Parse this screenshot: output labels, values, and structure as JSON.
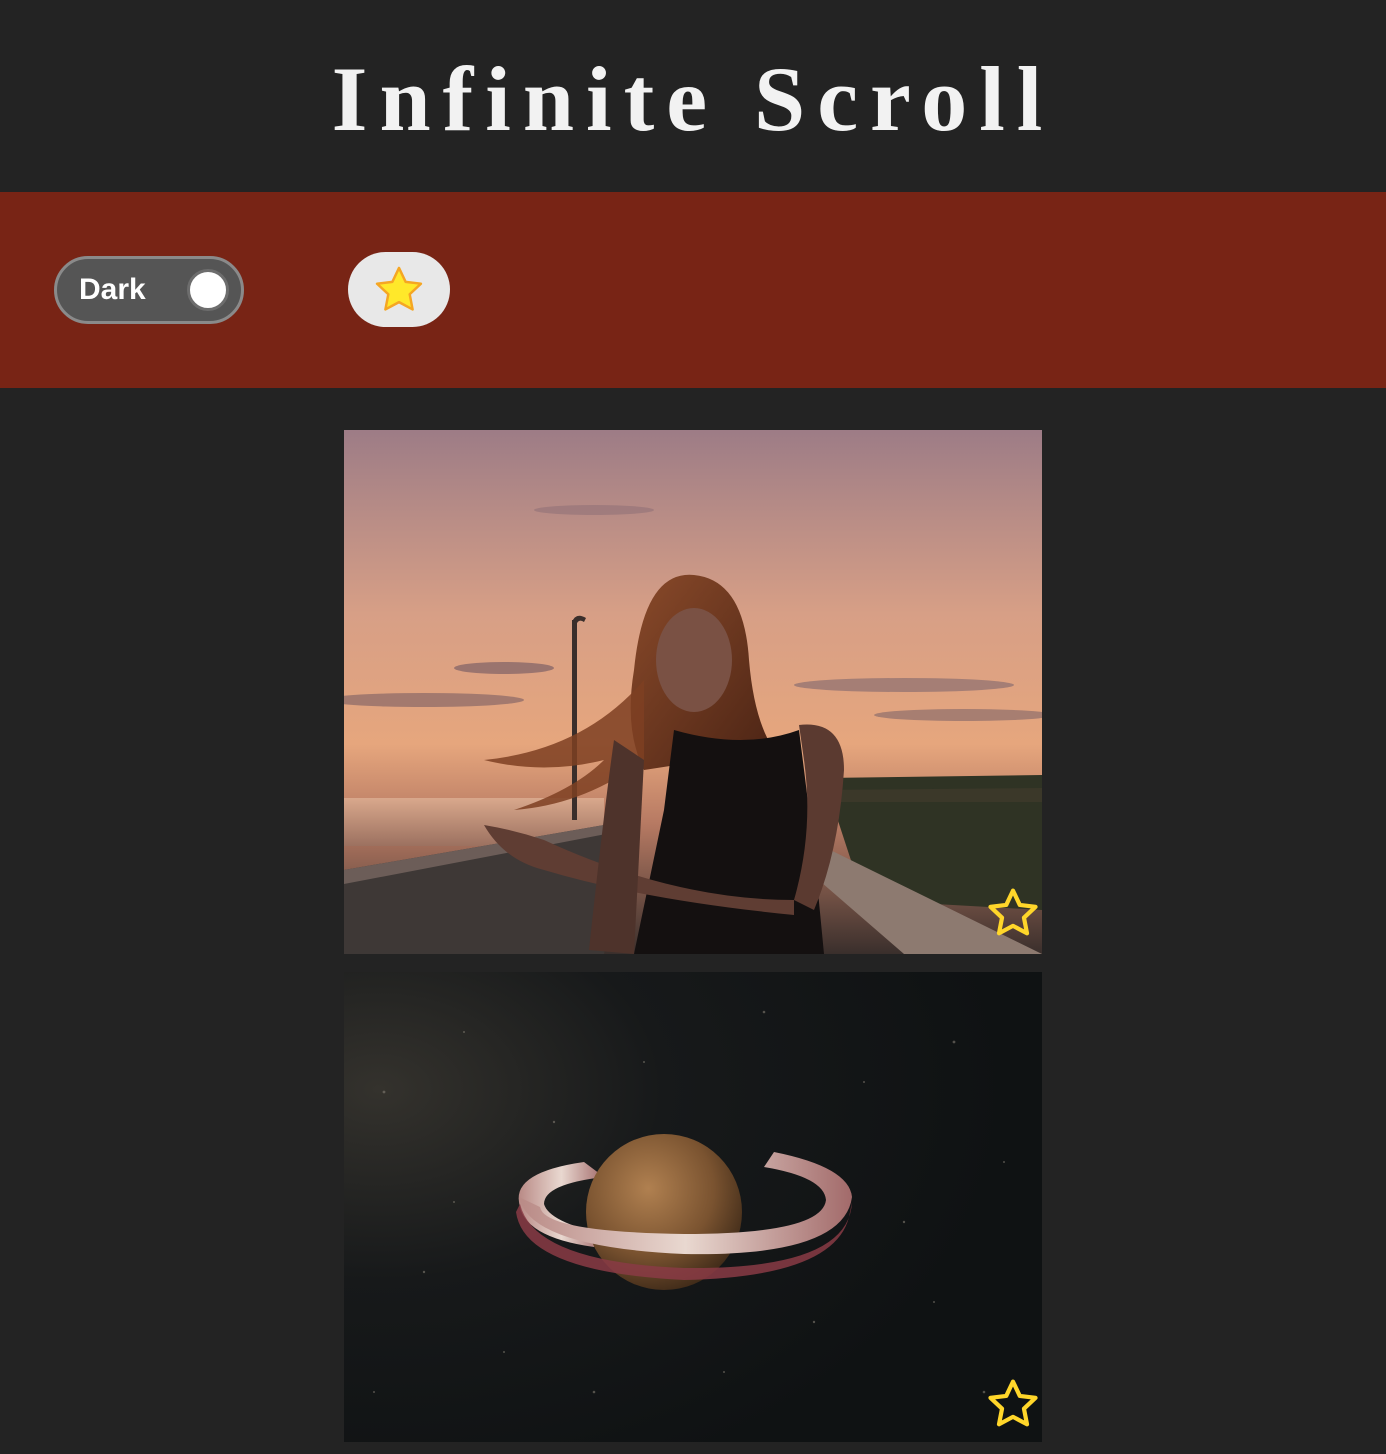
{
  "header": {
    "title": "Infinite Scroll"
  },
  "toolbar": {
    "theme_toggle_label": "Dark",
    "theme_toggle_state": "dark",
    "favorites_filter_icon": "star-filled-icon"
  },
  "colors": {
    "page_background": "#232323",
    "title_text": "#f2f2f2",
    "toolbar_background": "#782415",
    "toggle_background": "#555555",
    "star_yellow": "#ffde17",
    "star_outline": "#f5a623"
  },
  "photos": [
    {
      "subject": "woman at sunset",
      "favorite_icon": "star-outline-icon",
      "favorited": false
    },
    {
      "subject": "planet made of food",
      "favorite_icon": "star-outline-icon",
      "favorited": false
    }
  ]
}
